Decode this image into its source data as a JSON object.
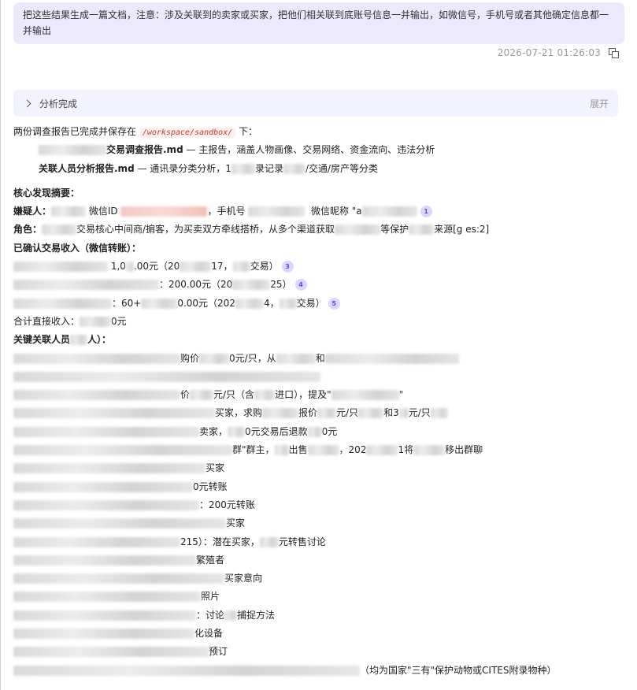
{
  "user_message": "把这些结果生成一篇文档，注意：涉及关联到的卖家或买家，把他们相关联到底账号信息一并输出，如微信号，手机号或者其他确定信息都一并输出",
  "timestamp": "2026-07-21 01:26:03",
  "analysis": {
    "label": "分析完成",
    "expand": "展开"
  },
  "intro": {
    "before": "两份调查报告已完成并保存在",
    "path": "/workspace/sandbox/",
    "after": "下："
  },
  "files": [
    {
      "name": "交易调查报告.md",
      "desc": "— 主报告，涵盖人物画像、交易网络、资金流向、违法分析"
    },
    {
      "name": "关联人员分析报告.md",
      "desc": "— 通讯录分类分析，1",
      "desc2": "录记录",
      "desc3": "/交通/房产等分类"
    }
  ],
  "findings": {
    "heading": "核心发现摘要：",
    "suspect_label": "嫌疑人：",
    "wechat_id": "微信ID",
    "phone": "，手机号",
    "nickname": "微信昵称 \"a",
    "role_label": "角色：",
    "role_a": "交易核心中间商/掮客，为买卖双方牵线搭桥，从多个渠道获取",
    "role_b": "等保护",
    "role_c": "来源[g es:2]",
    "income_label": "已确认交易收入（微信转账）：",
    "income_1": "1,0",
    "income_1b": ".00元（20",
    "income_1c": "17，",
    "income_1d": "交易）",
    "income_2": "：200.00元（20",
    "income_2b": "25）",
    "income_3": "：60+",
    "income_3b": "0.00元（202",
    "income_3c": "4，",
    "income_3d": "交易）",
    "total": "合计直接收入：",
    "total_b": "0元",
    "key_people": "关键关联人员",
    "key_people_b": "人）："
  },
  "citations": [
    "1",
    "3",
    "4",
    "5"
  ],
  "people_rows": [
    {
      "a": "购价",
      "b": "0元/只，从",
      "c": "和"
    },
    {
      "a": "",
      "b": "",
      "c": ""
    },
    {
      "a": "价",
      "b": "元/只（含",
      "c": "进口），提及\"",
      "d": "\""
    },
    {
      "a": "买家，求购",
      "b": "报价",
      "c": "元/只",
      "d": "和3",
      "e": "元/只"
    },
    {
      "a": "卖家，",
      "b": "0元交易后退款",
      "c": "0元"
    },
    {
      "a": "群\"群主，",
      "b": "出售",
      "c": "，202",
      "d": "1将",
      "e": "移出群聊"
    },
    {
      "a": "买家"
    },
    {
      "a": "0元转账"
    },
    {
      "a": "：200元转账"
    },
    {
      "a": "买家"
    },
    {
      "a": "215）：潜在买家，",
      "b": "元转售讨论"
    },
    {
      "a": "繁殖者"
    },
    {
      "a": "买家意向"
    },
    {
      "a": "照片"
    },
    {
      "a": "：讨论",
      "b": "捕捉方法"
    },
    {
      "a": "化设备"
    },
    {
      "a": "预订"
    },
    {
      "a": "（均为国家\"三有\"保护动物或CITES附录物种）"
    }
  ]
}
